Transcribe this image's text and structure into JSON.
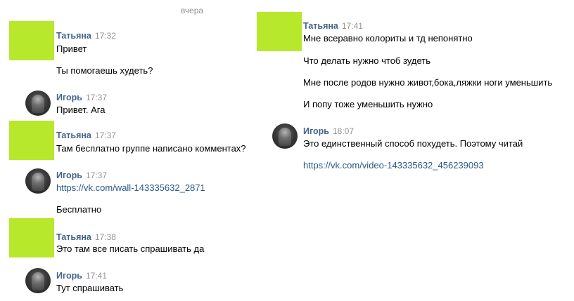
{
  "date_divider": "вчера",
  "users": {
    "tatyana": "Татьяна",
    "igor": "Игорь"
  },
  "left_column": [
    {
      "sender": "Татьяна",
      "time": "17:32",
      "lines": [
        "Привет",
        "Ты помогаешь худеть?"
      ]
    },
    {
      "sender": "Игорь",
      "time": "17:37",
      "lines": [
        "Привет. Ага"
      ]
    },
    {
      "sender": "Татьяна",
      "time": "17:37",
      "lines": [
        "Там бесплатно группе написано комментах?"
      ]
    },
    {
      "sender": "Игорь",
      "time": "17:37",
      "lines": [
        "https://vk.com/wall-143335632_2871",
        "Бесплатно"
      ]
    },
    {
      "sender": "Татьяна",
      "time": "17:38",
      "lines": [
        "Это там все писать спрашивать да"
      ]
    },
    {
      "sender": "Игорь",
      "time": "17:41",
      "lines": [
        "Тут спрашивать"
      ]
    }
  ],
  "right_column": [
    {
      "sender": "Татьяна",
      "time": "17:41",
      "lines": [
        "Мне всеравно колориты и тд непонятно",
        "Что делать нужно чтоб зудеть",
        "Мне после родов нужно живот,бока,ляжки ноги уменьшить",
        "И попу тоже уменьшить нужно"
      ]
    },
    {
      "sender": "Игорь",
      "time": "18:07",
      "lines": [
        "Это единственный способ похудеть. Поэтому читай",
        "https://vk.com/video-143335632_456239093"
      ]
    }
  ],
  "colors": {
    "name": "#42648b",
    "time": "#939393",
    "link": "#2a5885",
    "avatar_placeholder": "#b8e82c"
  }
}
